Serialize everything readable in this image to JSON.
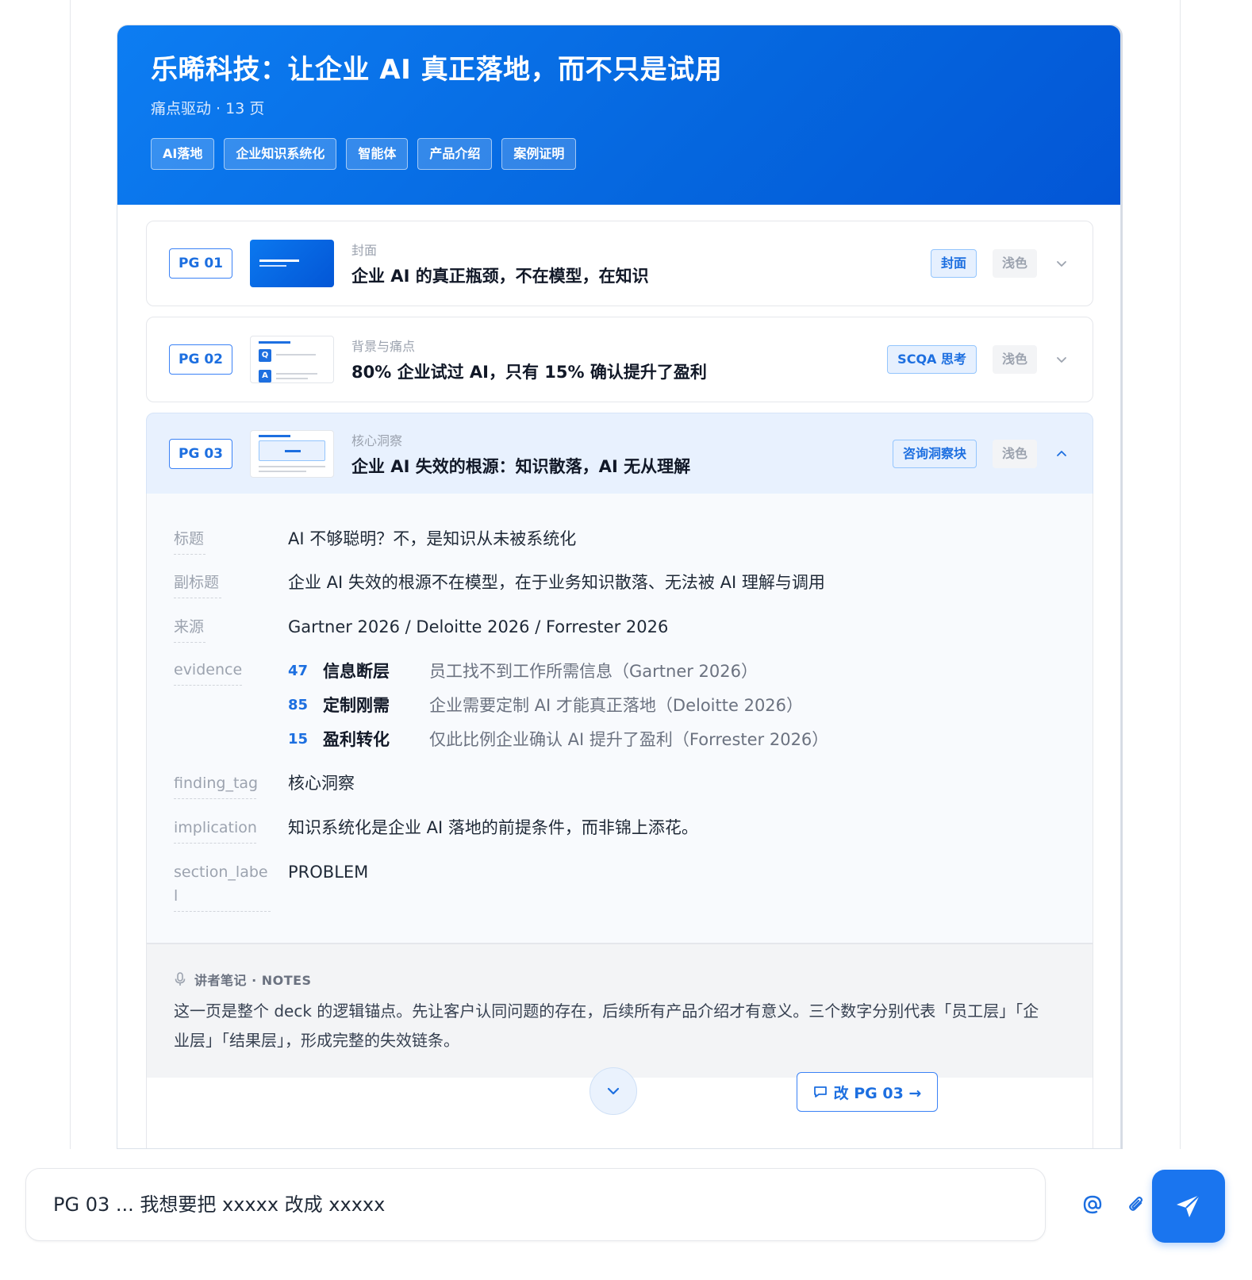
{
  "deck": {
    "title": "乐晞科技：让企业 AI 真正落地，而不只是试用",
    "subtitle": "痛点驱动 · 13 页",
    "tags": [
      "AI落地",
      "企业知识系统化",
      "智能体",
      "产品介绍",
      "案例证明"
    ]
  },
  "slides": [
    {
      "pg": "PG 01",
      "kicker": "封面",
      "title": "企业 AI 的真正瓶颈，不在模型，在知识",
      "type": "封面",
      "theme": "浅色"
    },
    {
      "pg": "PG 02",
      "kicker": "背景与痛点",
      "title": "80% 企业试过 AI，只有 15% 确认提升了盈利",
      "type": "SCQA 思考",
      "theme": "浅色"
    },
    {
      "pg": "PG 03",
      "kicker": "核心洞察",
      "title": "企业 AI 失效的根源：知识散落，AI 无从理解",
      "type": "咨询洞察块",
      "theme": "浅色"
    }
  ],
  "detail": {
    "labels": {
      "title": "标题",
      "subtitle": "副标题",
      "source": "来源",
      "evidence": "evidence",
      "finding_tag": "finding_tag",
      "implication": "implication",
      "section_label": "section_label"
    },
    "title": "AI 不够聪明？不，是知识从未被系统化",
    "subtitle": "企业 AI 失效的根源不在模型，在于业务知识散落、无法被 AI 理解与调用",
    "source": "Gartner 2026 / Deloitte 2026 / Forrester 2026",
    "evidence": [
      {
        "num": "47",
        "name": "信息断层",
        "desc": "员工找不到工作所需信息（Gartner 2026）"
      },
      {
        "num": "85",
        "name": "定制刚需",
        "desc": "企业需要定制 AI 才能真正落地（Deloitte 2026）"
      },
      {
        "num": "15",
        "name": "盈利转化",
        "desc": "仅此比例企业确认 AI 提升了盈利（Forrester 2026）"
      }
    ],
    "finding_tag": "核心洞察",
    "implication": "知识系统化是企业 AI 落地的前提条件，而非锦上添花。",
    "section_label": "PROBLEM"
  },
  "notes": {
    "heading": "讲者笔记 · NOTES",
    "body": "这一页是整个 deck 的逻辑锚点。先让客户认同问题的存在，后续所有产品介绍才有意义。三个数字分别代表「员工层」「企业层」「结果层」，形成完整的失效链条。"
  },
  "actions": {
    "edit_label": "改 PG 03 →"
  },
  "composer": {
    "value": "PG 03 ... 我想要把 xxxxx 改成 xxxxx",
    "placeholder": ""
  },
  "colors": {
    "accent": "#1d6fe0",
    "hero": "#0566de",
    "active_row": "#e8f1fe"
  }
}
